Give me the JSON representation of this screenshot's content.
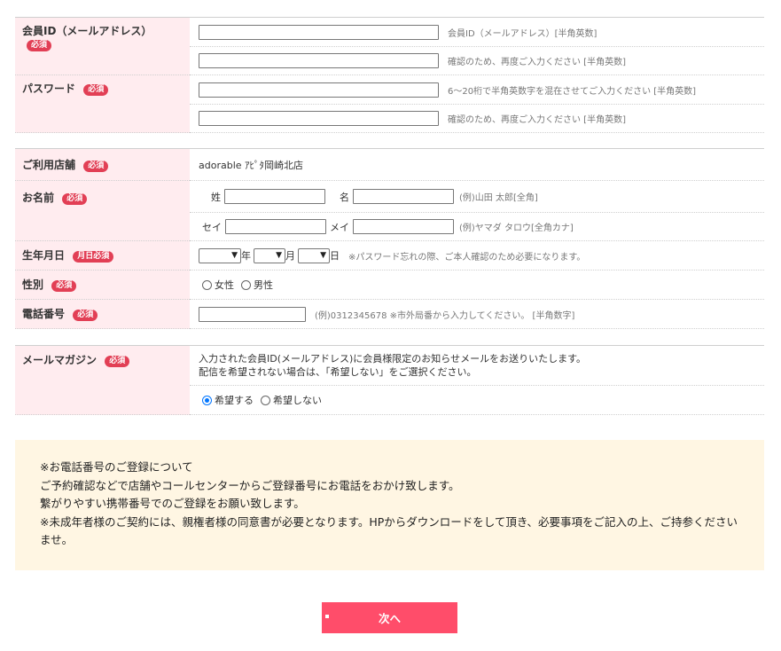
{
  "account": {
    "member_id_label": "会員ID（メールアドレス）",
    "member_id_hint": "会員ID（メールアドレス）[半角英数]",
    "member_id_confirm_hint": "確認のため、再度ご入力ください [半角英数]",
    "password_label": "パスワード",
    "password_hint": "6～20桁で半角英数字を混在させてご入力ください [半角英数]",
    "password_confirm_hint": "確認のため、再度ご入力ください [半角英数]"
  },
  "required_badge": "必須",
  "birth_required_badge": "月日必須",
  "profile": {
    "store_label": "ご利用店舗",
    "store_value": "adorable ｱﾋﾟﾀ岡崎北店",
    "name_label": "お名前",
    "sei_label": "姓",
    "mei_label": "名",
    "name_hint": "(例)山田 太郎[全角]",
    "sei_kana_label": "セイ",
    "mei_kana_label": "メイ",
    "kana_hint": "(例)ヤマダ タロウ[全角カナ]",
    "birth_label": "生年月日",
    "year_unit": "年",
    "month_unit": "月",
    "day_unit": "日",
    "birth_hint": "※パスワード忘れの際、ご本人確認のため必要になります。",
    "gender_label": "性別",
    "female": "女性",
    "male": "男性",
    "phone_label": "電話番号",
    "phone_hint": "(例)0312345678 ※市外局番から入力してください。 [半角数字]"
  },
  "magazine": {
    "label": "メールマガジン",
    "desc1": "入力された会員ID(メールアドレス)に会員様限定のお知らせメールをお送りいたします。",
    "desc2": "配信を希望されない場合は、「希望しない」をご選択ください。",
    "opt_yes": "希望する",
    "opt_no": "希望しない",
    "selected": "希望する"
  },
  "notice": {
    "line1": "※お電話番号のご登録について",
    "line2": "ご予約確認などで店舗やコールセンターからご登録番号にお電話をおかけ致します。",
    "line3": "繋がりやすい携帯番号でのご登録をお願い致します。",
    "line4": "※未成年者様のご契約には、親権者様の同意書が必要となります。HPからダウンロードをして頂き、必要事項をご記入の上、ご持参くださいませ。"
  },
  "next_button": "次へ"
}
